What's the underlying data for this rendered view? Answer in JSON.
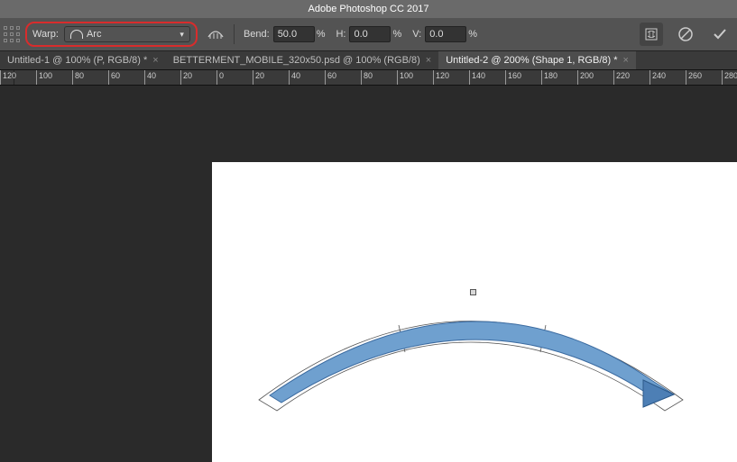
{
  "title": "Adobe Photoshop CC 2017",
  "options": {
    "warp_label": "Warp:",
    "warp_value": "Arc",
    "bend_label": "Bend:",
    "bend_value": "50.0",
    "bend_unit": "%",
    "h_label": "H:",
    "h_value": "0.0",
    "h_unit": "%",
    "v_label": "V:",
    "v_value": "0.0",
    "v_unit": "%"
  },
  "tabs": [
    {
      "label": "Untitled-1 @ 100% (P, RGB/8) *",
      "active": false
    },
    {
      "label": "BETTERMENT_MOBILE_320x50.psd @ 100% (RGB/8)",
      "active": false
    },
    {
      "label": "Untitled-2 @ 200% (Shape 1, RGB/8) *",
      "active": true
    }
  ],
  "ruler_marks": [
    {
      "pos": 0,
      "label": "120"
    },
    {
      "pos": 40,
      "label": "100"
    },
    {
      "pos": 80,
      "label": "80"
    },
    {
      "pos": 120,
      "label": "60"
    },
    {
      "pos": 160,
      "label": "40"
    },
    {
      "pos": 200,
      "label": "20"
    },
    {
      "pos": 240,
      "label": "0"
    },
    {
      "pos": 280,
      "label": "20"
    },
    {
      "pos": 320,
      "label": "40"
    },
    {
      "pos": 360,
      "label": "60"
    },
    {
      "pos": 400,
      "label": "80"
    },
    {
      "pos": 440,
      "label": "100"
    },
    {
      "pos": 480,
      "label": "120"
    },
    {
      "pos": 520,
      "label": "140"
    },
    {
      "pos": 560,
      "label": "160"
    },
    {
      "pos": 600,
      "label": "180"
    },
    {
      "pos": 640,
      "label": "200"
    },
    {
      "pos": 680,
      "label": "220"
    },
    {
      "pos": 720,
      "label": "240"
    },
    {
      "pos": 760,
      "label": "260"
    },
    {
      "pos": 800,
      "label": "280"
    }
  ]
}
